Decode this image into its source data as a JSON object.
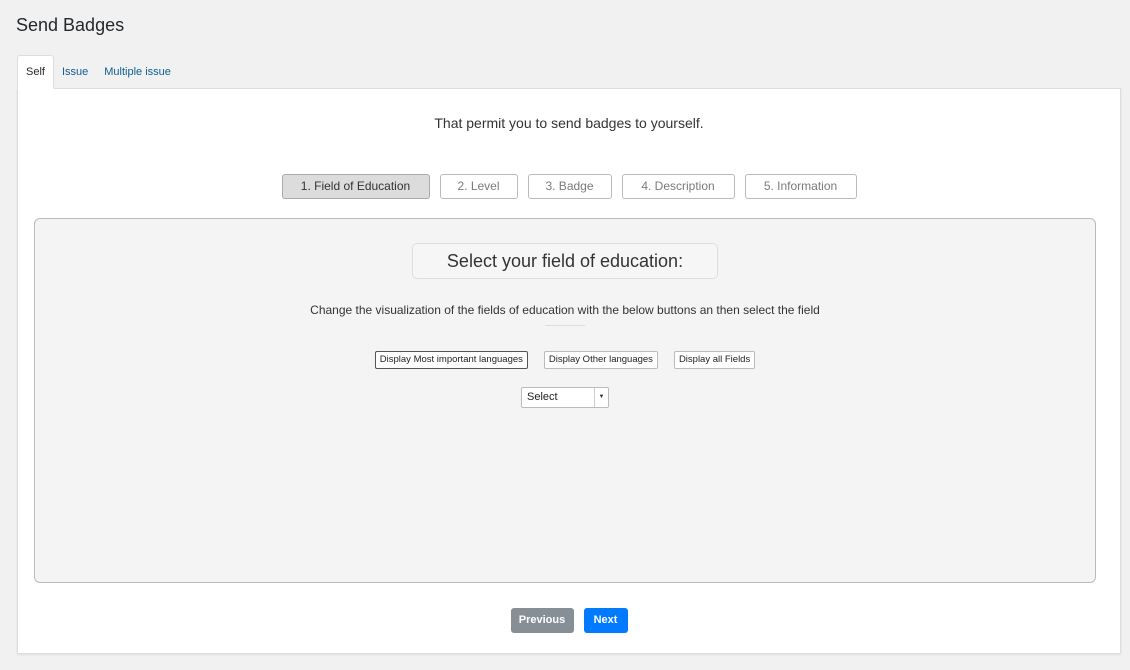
{
  "page": {
    "title": "Send Badges"
  },
  "tabs": [
    {
      "label": "Self",
      "active": true
    },
    {
      "label": "Issue",
      "active": false
    },
    {
      "label": "Multiple issue",
      "active": false
    }
  ],
  "intro": "That permit you to send badges to yourself.",
  "steps": [
    {
      "label": "1. Field of Education",
      "active": true
    },
    {
      "label": "2. Level",
      "active": false
    },
    {
      "label": "3. Badge",
      "active": false
    },
    {
      "label": "4. Description",
      "active": false
    },
    {
      "label": "5. Information",
      "active": false
    }
  ],
  "wizard": {
    "question": "Select your field of education:",
    "instruction": "Change the visualization of the fields of education with the below buttons an then select the field",
    "filters": [
      {
        "label": "Display Most important languages",
        "selected": true
      },
      {
        "label": "Display Other languages",
        "selected": false
      },
      {
        "label": "Display all Fields",
        "selected": false
      }
    ],
    "select": {
      "value": "Select"
    }
  },
  "nav": {
    "previous": "Previous",
    "next": "Next"
  },
  "colors": {
    "primary": "#007bff",
    "secondary": "#868e96",
    "link": "#0e5d93"
  }
}
